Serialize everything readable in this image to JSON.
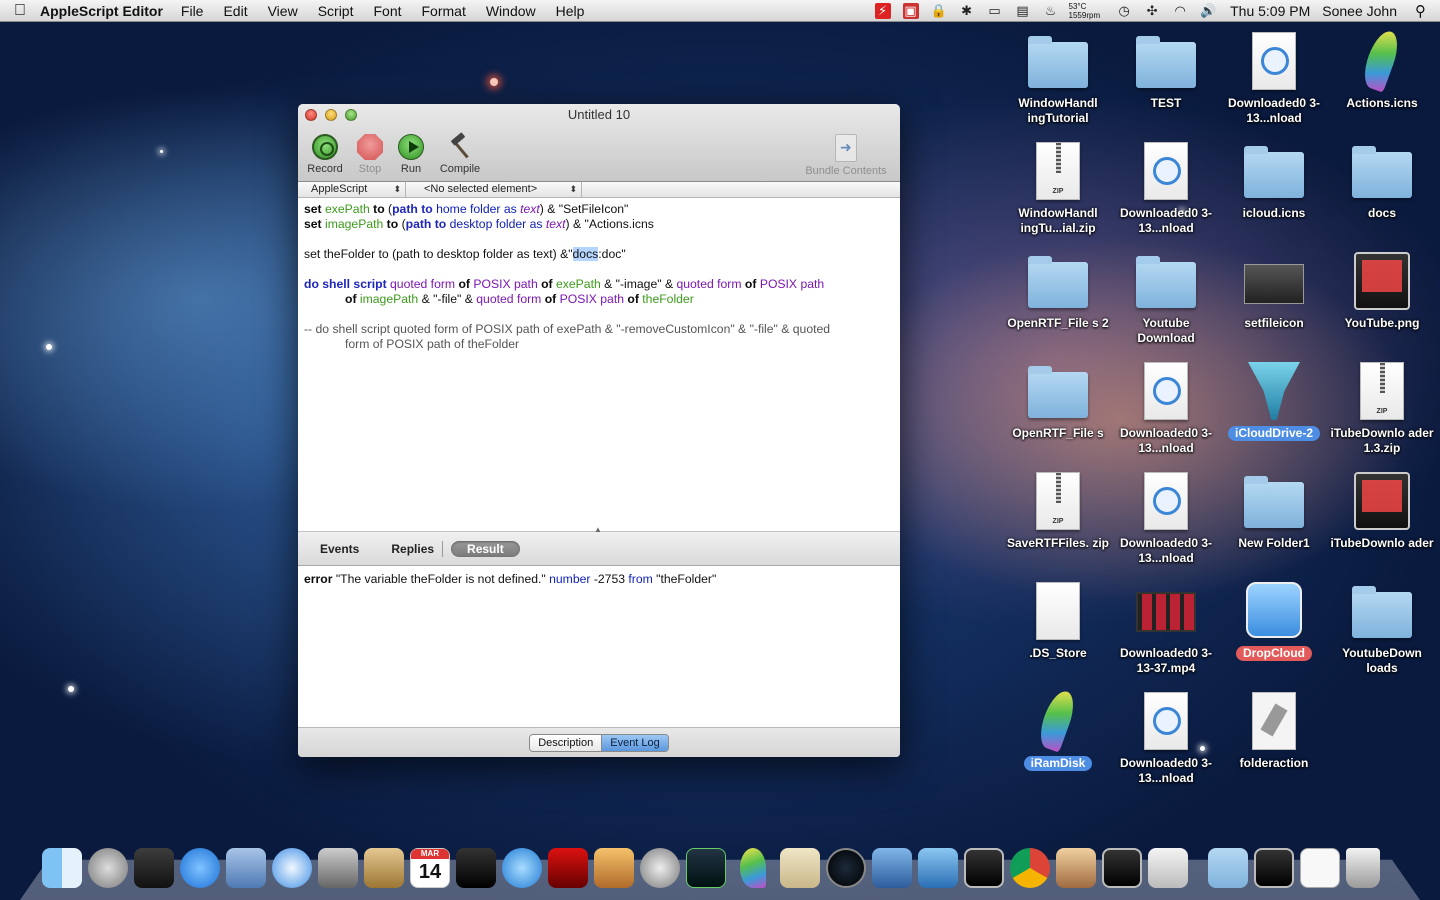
{
  "menubar": {
    "app_name": "AppleScript Editor",
    "menus": [
      "File",
      "Edit",
      "View",
      "Script",
      "Font",
      "Format",
      "Window",
      "Help"
    ],
    "temp_line1": "53°C",
    "temp_line2": "1559rpm",
    "clock": "Thu 5:09 PM",
    "user": "Sonee John"
  },
  "window": {
    "title": "Untitled 10",
    "toolbar": {
      "record": "Record",
      "stop": "Stop",
      "run": "Run",
      "compile": "Compile",
      "bundle": "Bundle Contents"
    },
    "navbar": {
      "language": "AppleScript",
      "element": "<No selected element>"
    },
    "code": {
      "l1": {
        "a": "set",
        "b": "exePath",
        "c": "to",
        "d": "(",
        "e": "path to",
        "f": "home folder",
        "g": "as",
        "h": "text",
        "i": ") & \"SetFileIcon\""
      },
      "l2": {
        "a": "set",
        "b": "imagePath",
        "c": "to",
        "d": "(",
        "e": "path to",
        "f": "desktop folder",
        "g": "as",
        "h": "text",
        "i": ") & \"Actions.icns"
      },
      "l4a": "set theFolder to (path to desktop folder as text) &\"",
      "l4sel": "docs",
      "l4b": ":doc\"",
      "l6": {
        "a": "do shell script",
        "b": "quoted form",
        "c": "of",
        "d": "POSIX path",
        "e": "of",
        "f": "exePath",
        "g": "& \"-image\" &",
        "h": "quoted form",
        "i": "of",
        "j": "POSIX path"
      },
      "l7": {
        "a": "of",
        "b": "imagePath",
        "c": "& \"-file\" &",
        "d": "quoted form",
        "e": "of",
        "f": "POSIX path",
        "g": "of",
        "h": "theFolder"
      },
      "l9": "-- do shell script quoted form of POSIX path of exePath & \"-removeCustomIcon\" & \"-file\" & quoted",
      "l10": "form of POSIX path of theFolder"
    },
    "log_tabs": {
      "events": "Events",
      "replies": "Replies",
      "result": "Result"
    },
    "result": {
      "a": "error",
      "b": "\"The variable theFolder is not defined.\"",
      "c": "number",
      "d": "-2753",
      "e": "from",
      "f": "\"theFolder\""
    },
    "bottom": {
      "description": "Description",
      "event_log": "Event Log"
    }
  },
  "desktop": {
    "icons": [
      {
        "label": "WindowHandl ingTutorial",
        "type": "folder"
      },
      {
        "label": "TEST",
        "type": "folder"
      },
      {
        "label": "Downloaded0 3-13...nload",
        "type": "download-doc"
      },
      {
        "label": "Actions.icns",
        "type": "feather"
      },
      {
        "label": "WindowHandl ingTu...ial.zip",
        "type": "zip"
      },
      {
        "label": "Downloaded0 3-13...nload",
        "type": "download-doc"
      },
      {
        "label": "icloud.icns",
        "type": "folder"
      },
      {
        "label": "docs",
        "type": "folder"
      },
      {
        "label": "OpenRTF_File s 2",
        "type": "folder"
      },
      {
        "label": "Youtube Download",
        "type": "folder"
      },
      {
        "label": "setfileicon",
        "type": "terminal"
      },
      {
        "label": "YouTube.png",
        "type": "dark-app"
      },
      {
        "label": "OpenRTF_File s",
        "type": "folder"
      },
      {
        "label": "Downloaded0 3-13...nload",
        "type": "download-doc"
      },
      {
        "label": "iCloudDrive-2",
        "type": "tornado"
      },
      {
        "label": "iTubeDownlo ader 1.3.zip",
        "type": "zip"
      },
      {
        "label": "SaveRTFFiles. zip",
        "type": "zip"
      },
      {
        "label": "Downloaded0 3-13...nload",
        "type": "download-doc"
      },
      {
        "label": "New Folder1",
        "type": "folder"
      },
      {
        "label": "iTubeDownlo ader",
        "type": "dark-app"
      },
      {
        "label": ".DS_Store",
        "type": "blank-doc"
      },
      {
        "label": "Downloaded0 3-13-37.mp4",
        "type": "video"
      },
      {
        "label": "DropCloud",
        "type": "cloud-app"
      },
      {
        "label": "YoutubeDown loads",
        "type": "folder"
      },
      {
        "label": "iRamDisk",
        "type": "feather"
      },
      {
        "label": "Downloaded0 3-13...nload",
        "type": "download-doc"
      },
      {
        "label": "folderaction",
        "type": "script-doc"
      }
    ]
  },
  "dock": {
    "calendar_month": "MAR",
    "calendar_day": "14"
  }
}
